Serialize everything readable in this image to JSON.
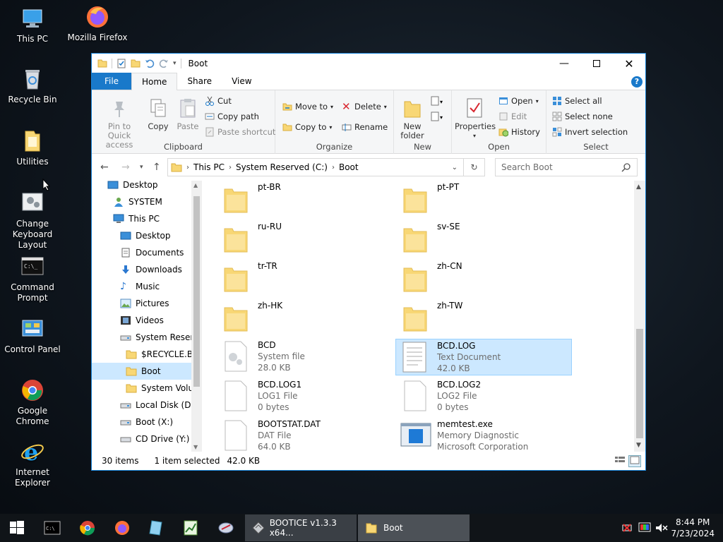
{
  "desktop": {
    "icons": [
      {
        "label": "This PC"
      },
      {
        "label": "Mozilla Firefox"
      },
      {
        "label": "Recycle Bin"
      },
      {
        "label": "Utilities"
      },
      {
        "label": "Change Keyboard Layout"
      },
      {
        "label": "Command Prompt"
      },
      {
        "label": "Control Panel"
      },
      {
        "label": "Google Chrome"
      },
      {
        "label": "Internet Explorer"
      }
    ]
  },
  "window": {
    "title": "Boot",
    "tabs": [
      "File",
      "Home",
      "Share",
      "View"
    ],
    "help": "?",
    "ribbon": {
      "clipboard": {
        "pin": "Pin to Quick access",
        "copy": "Copy",
        "paste": "Paste",
        "cut": "Cut",
        "copy_path": "Copy path",
        "paste_shortcut": "Paste shortcut",
        "label": "Clipboard"
      },
      "organize": {
        "move_to": "Move to",
        "copy_to": "Copy to",
        "delete": "Delete",
        "rename": "Rename",
        "label": "Organize"
      },
      "new": {
        "new_folder": "New folder",
        "label": "New"
      },
      "open": {
        "properties": "Properties",
        "open": "Open",
        "edit": "Edit",
        "history": "History",
        "label": "Open"
      },
      "select": {
        "select_all": "Select all",
        "select_none": "Select none",
        "invert": "Invert selection",
        "label": "Select"
      }
    },
    "address": {
      "crumbs": [
        "This PC",
        "System Reserved (C:)",
        "Boot"
      ],
      "search_placeholder": "Search Boot"
    },
    "nav": [
      {
        "label": "Desktop",
        "level": 0
      },
      {
        "label": "SYSTEM",
        "level": 1
      },
      {
        "label": "This PC",
        "level": 1
      },
      {
        "label": "Desktop",
        "level": 2
      },
      {
        "label": "Documents",
        "level": 2
      },
      {
        "label": "Downloads",
        "level": 2
      },
      {
        "label": "Music",
        "level": 2
      },
      {
        "label": "Pictures",
        "level": 2
      },
      {
        "label": "Videos",
        "level": 2
      },
      {
        "label": "System Reserve",
        "level": 2
      },
      {
        "label": "$RECYCLE.BIN",
        "level": 3
      },
      {
        "label": "Boot",
        "level": 3,
        "selected": true
      },
      {
        "label": "System Volun",
        "level": 3
      },
      {
        "label": "Local Disk (D:)",
        "level": 2
      },
      {
        "label": "Boot (X:)",
        "level": 2
      },
      {
        "label": "CD Drive (Y:) H",
        "level": 2
      }
    ],
    "items": [
      {
        "name": "pt-BR",
        "type": "folder"
      },
      {
        "name": "pt-PT",
        "type": "folder"
      },
      {
        "name": "ru-RU",
        "type": "folder"
      },
      {
        "name": "sv-SE",
        "type": "folder"
      },
      {
        "name": "tr-TR",
        "type": "folder"
      },
      {
        "name": "zh-CN",
        "type": "folder"
      },
      {
        "name": "zh-HK",
        "type": "folder"
      },
      {
        "name": "zh-TW",
        "type": "folder"
      },
      {
        "name": "BCD",
        "type": "sysfile",
        "line2": "System file",
        "line3": "28.0 KB"
      },
      {
        "name": "BCD.LOG",
        "type": "textdoc",
        "line2": "Text Document",
        "line3": "42.0 KB",
        "selected": true
      },
      {
        "name": "BCD.LOG1",
        "type": "file",
        "line2": "LOG1 File",
        "line3": "0 bytes"
      },
      {
        "name": "BCD.LOG2",
        "type": "file",
        "line2": "LOG2 File",
        "line3": "0 bytes"
      },
      {
        "name": "BOOTSTAT.DAT",
        "type": "file",
        "line2": "DAT File",
        "line3": "64.0 KB"
      },
      {
        "name": "memtest.exe",
        "type": "exe",
        "line2": "Memory Diagnostic",
        "line3": "Microsoft Corporation"
      }
    ],
    "status": {
      "count": "30 items",
      "selected": "1 item selected",
      "size": "42.0 KB"
    }
  },
  "taskbar": {
    "apps": [
      {
        "label": "BOOTICE v1.3.3 x64..."
      },
      {
        "label": "Boot"
      }
    ],
    "time": "8:44 PM",
    "date": "7/23/2024"
  },
  "colors": {
    "accent": "#1979ca",
    "selection": "#cce8ff",
    "folder": "#f8d775",
    "taskbar": "#101418"
  }
}
